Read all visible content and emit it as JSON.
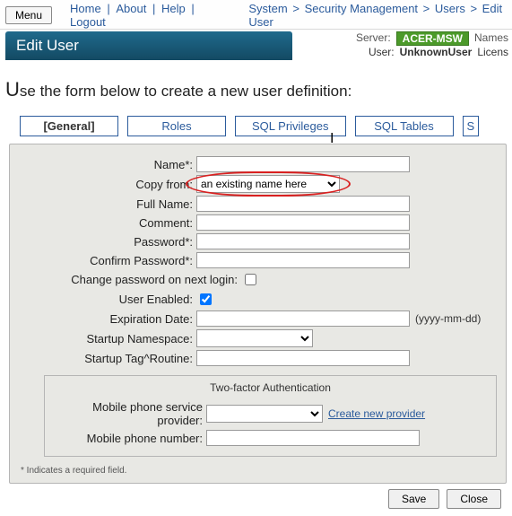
{
  "top": {
    "menu_label": "Menu",
    "nav": {
      "home": "Home",
      "about": "About",
      "help": "Help",
      "logout": "Logout"
    },
    "breadcrumb": {
      "a": "System",
      "b": "Security Management",
      "c": "Users",
      "d": "Edit User"
    },
    "server_lbl": "Server:",
    "server_val": "ACER-MSW",
    "names_lbl": "Names",
    "user_lbl": "User:",
    "user_val": "UnknownUser",
    "licens_lbl": "Licens"
  },
  "page": {
    "title": "Edit User",
    "intro_pre": "U",
    "intro_rest": "se the form below to create a new user definition:"
  },
  "tabs": {
    "general": "[General]",
    "roles": "Roles",
    "sql_priv": "SQL Privileges",
    "sql_tables": "SQL Tables",
    "trunc": "S"
  },
  "form": {
    "name_lbl": "Name*:",
    "copy_lbl": "Copy from:",
    "copy_placeholder": "an existing name here",
    "full_name_lbl": "Full Name:",
    "comment_lbl": "Comment:",
    "password_lbl": "Password*:",
    "confirm_lbl": "Confirm Password*:",
    "chg_pwd_lbl": "Change password on next login:",
    "enabled_lbl": "User Enabled:",
    "exp_lbl": "Expiration Date:",
    "exp_hint": "(yyyy-mm-dd)",
    "ns_lbl": "Startup Namespace:",
    "tagroutine_lbl": "Startup Tag^Routine:",
    "twofa_title": "Two-factor Authentication",
    "provider_lbl": "Mobile phone service provider:",
    "create_prov": "Create new provider",
    "phone_lbl": "Mobile phone number:",
    "footnote": "* Indicates a required field."
  },
  "actions": {
    "save": "Save",
    "close": "Close"
  }
}
